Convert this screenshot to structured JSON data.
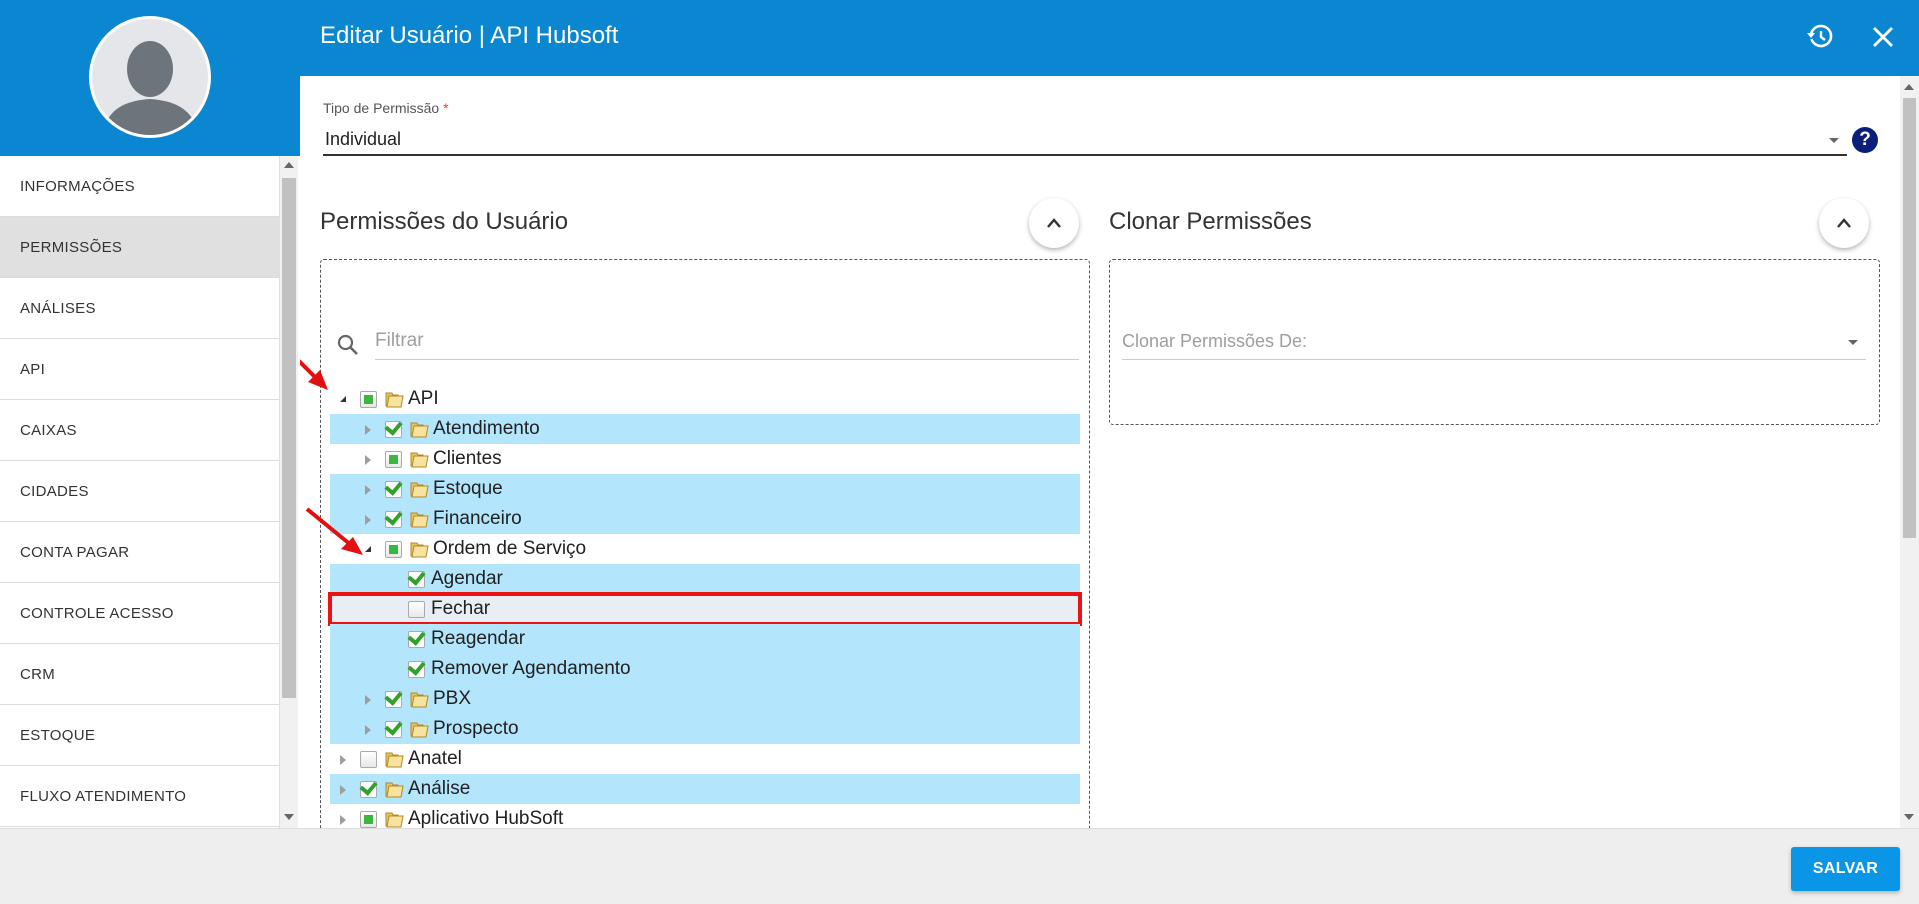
{
  "header": {
    "title": "Editar Usuário | API Hubsoft"
  },
  "sidebar": {
    "items": [
      {
        "label": "INFORMAÇÕES",
        "active": false
      },
      {
        "label": "PERMISSÕES",
        "active": true
      },
      {
        "label": "ANÁLISES",
        "active": false
      },
      {
        "label": "API",
        "active": false
      },
      {
        "label": "CAIXAS",
        "active": false
      },
      {
        "label": "CIDADES",
        "active": false
      },
      {
        "label": "CONTA PAGAR",
        "active": false
      },
      {
        "label": "CONTROLE ACESSO",
        "active": false
      },
      {
        "label": "CRM",
        "active": false
      },
      {
        "label": "ESTOQUE",
        "active": false
      },
      {
        "label": "FLUXO ATENDIMENTO",
        "active": false
      }
    ]
  },
  "permission_type": {
    "label": "Tipo de Permissão",
    "required_mark": "*",
    "value": "Individual"
  },
  "user_permissions": {
    "title": "Permissões do Usuário",
    "filter_placeholder": "Filtrar",
    "tree": [
      {
        "label": "API",
        "level": 0,
        "expander": "open",
        "check": "partial",
        "folder": true,
        "highlight": false
      },
      {
        "label": "Atendimento",
        "level": 1,
        "expander": "closed",
        "check": "full",
        "folder": true,
        "highlight": true
      },
      {
        "label": "Clientes",
        "level": 1,
        "expander": "closed",
        "check": "partial",
        "folder": true,
        "highlight": false
      },
      {
        "label": "Estoque",
        "level": 1,
        "expander": "closed",
        "check": "full",
        "folder": true,
        "highlight": true
      },
      {
        "label": "Financeiro",
        "level": 1,
        "expander": "closed",
        "check": "full",
        "folder": true,
        "highlight": true
      },
      {
        "label": "Ordem de Serviço",
        "level": 1,
        "expander": "open",
        "check": "partial",
        "folder": true,
        "highlight": false
      },
      {
        "label": "Agendar",
        "level": 2,
        "expander": "none",
        "check": "full",
        "folder": false,
        "highlight": true
      },
      {
        "label": "Fechar",
        "level": 2,
        "expander": "none",
        "check": "none",
        "folder": false,
        "highlight": false,
        "selected": true
      },
      {
        "label": "Reagendar",
        "level": 2,
        "expander": "none",
        "check": "full",
        "folder": false,
        "highlight": true
      },
      {
        "label": "Remover Agendamento",
        "level": 2,
        "expander": "none",
        "check": "full",
        "folder": false,
        "highlight": true
      },
      {
        "label": "PBX",
        "level": 1,
        "expander": "closed",
        "check": "full",
        "folder": true,
        "highlight": true
      },
      {
        "label": "Prospecto",
        "level": 1,
        "expander": "closed",
        "check": "full",
        "folder": true,
        "highlight": true
      },
      {
        "label": "Anatel",
        "level": 0,
        "expander": "closed",
        "check": "none",
        "folder": true,
        "highlight": false
      },
      {
        "label": "Análise",
        "level": 0,
        "expander": "closed",
        "check": "full",
        "folder": true,
        "highlight": true
      },
      {
        "label": "Aplicativo HubSoft",
        "level": 0,
        "expander": "closed",
        "check": "partial",
        "folder": true,
        "highlight": false
      }
    ]
  },
  "clone_permissions": {
    "title": "Clonar Permissões",
    "placeholder": "Clonar Permissões De:"
  },
  "footer": {
    "save_label": "SALVAR"
  },
  "colors": {
    "brand": "#0b87d1",
    "highlight_row": "#b3e5fc",
    "annotation_red": "#e11111",
    "save_button": "#0b95e6"
  }
}
